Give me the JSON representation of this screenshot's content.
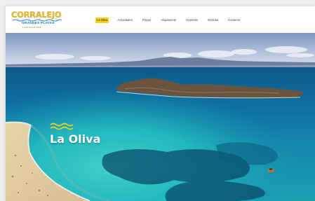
{
  "brand": {
    "name": "CORRALEJO",
    "subtitle": "GRANDES PLAYAS",
    "tagline": "FUERTEVENTURA"
  },
  "nav": {
    "items": [
      {
        "label": "La Oliva",
        "active": true
      },
      {
        "label": "Actividades",
        "active": false
      },
      {
        "label": "Playas",
        "active": false
      },
      {
        "label": "Alojamiento",
        "active": false
      },
      {
        "label": "Deportes",
        "active": false
      },
      {
        "label": "Noticias",
        "active": false
      },
      {
        "label": "Contacto",
        "active": false
      }
    ]
  },
  "hero": {
    "title": "La Oliva"
  },
  "colors": {
    "accent": "#f7d21c",
    "brand_blue": "#1d6fb3",
    "sea_deep": "#0b5f8e",
    "turquoise": "#1fb5b8"
  }
}
